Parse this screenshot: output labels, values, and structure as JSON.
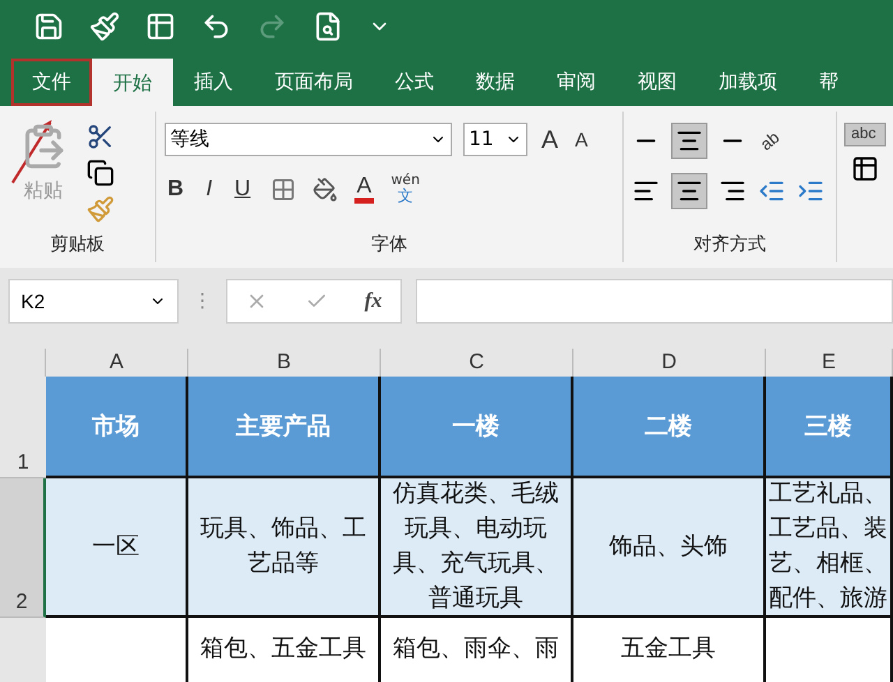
{
  "tabs": [
    {
      "label": "文件",
      "selected": false,
      "highlighted": true
    },
    {
      "label": "开始",
      "selected": true,
      "highlighted": false
    },
    {
      "label": "插入",
      "selected": false,
      "highlighted": false
    },
    {
      "label": "页面布局",
      "selected": false,
      "highlighted": false
    },
    {
      "label": "公式",
      "selected": false,
      "highlighted": false
    },
    {
      "label": "数据",
      "selected": false,
      "highlighted": false
    },
    {
      "label": "审阅",
      "selected": false,
      "highlighted": false
    },
    {
      "label": "视图",
      "selected": false,
      "highlighted": false
    },
    {
      "label": "加载项",
      "selected": false,
      "highlighted": false
    },
    {
      "label": "帮",
      "selected": false,
      "highlighted": false
    }
  ],
  "ribbon": {
    "clipboard": {
      "label": "剪贴板",
      "paste": "粘贴"
    },
    "font": {
      "label": "字体",
      "font_name": "等线",
      "font_size": "11",
      "grow": "A",
      "shrink": "A",
      "bold": "B",
      "italic": "I",
      "underline": "U",
      "font_color": "A",
      "phonetic_top": "wén",
      "phonetic_bottom": "文"
    },
    "alignment": {
      "label": "对齐方式",
      "orientation": "ab",
      "wrap": "abc"
    }
  },
  "formula_bar": {
    "name_box": "K2",
    "grip": "⋮",
    "fx": "fx"
  },
  "sheet": {
    "columns": [
      "A",
      "B",
      "C",
      "D",
      "E"
    ],
    "rows": [
      {
        "number": "1",
        "selected": false,
        "kind": "header",
        "cells": [
          "市场",
          "主要产品",
          "一楼",
          "二楼",
          "三楼"
        ]
      },
      {
        "number": "2",
        "selected": true,
        "kind": "data",
        "cells": [
          "一区",
          "玩具、饰品、工艺品等",
          "仿真花类、毛绒玩具、电动玩具、充气玩具、普通玩具",
          "饰品、头饰",
          "工艺礼品、工艺品、装艺、相框、配件、旅游"
        ]
      },
      {
        "number": "",
        "selected": false,
        "kind": "plain",
        "cells": [
          "",
          "箱包、五金工具",
          "箱包、雨伞、雨",
          "五金工具",
          ""
        ]
      }
    ]
  }
}
